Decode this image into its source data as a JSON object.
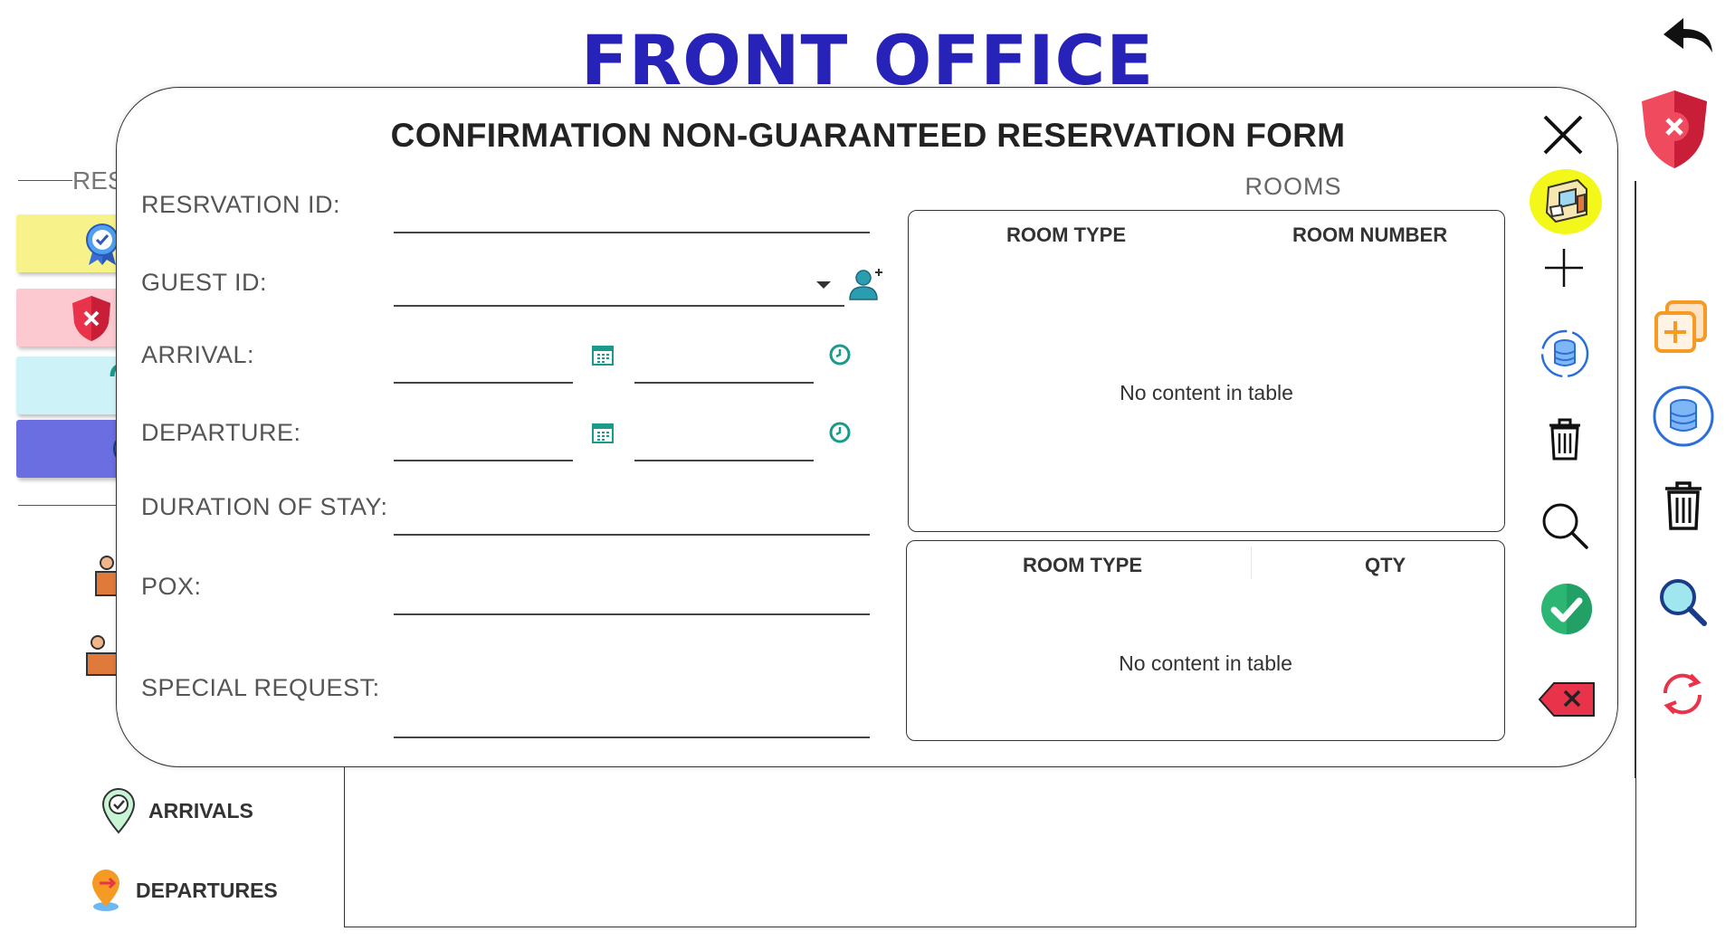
{
  "page": {
    "title": "FRONT OFFICE"
  },
  "background": {
    "section_label": "RES",
    "nav": {
      "arrivals": "ARRIVALS",
      "departures": "DEPARTURES"
    }
  },
  "modal": {
    "title": "CONFIRMATION NON-GUARANTEED RESERVATION FORM",
    "fields": {
      "reservation_id": {
        "label": "RESRVATION ID:",
        "value": ""
      },
      "guest_id": {
        "label": "GUEST ID:",
        "value": ""
      },
      "arrival": {
        "label": "ARRIVAL:",
        "date": "",
        "time": ""
      },
      "departure": {
        "label": "DEPARTURE:",
        "date": "",
        "time": ""
      },
      "duration": {
        "label": "DURATION OF STAY:",
        "value": ""
      },
      "pox": {
        "label": "POX:",
        "value": ""
      },
      "special_request": {
        "label": "SPECIAL REQUEST:",
        "value": ""
      }
    },
    "rooms": {
      "label": "ROOMS",
      "table1": {
        "columns": [
          "ROOM TYPE",
          "ROOM NUMBER"
        ],
        "empty_text": "No content in table"
      },
      "table2": {
        "columns": [
          "ROOM TYPE",
          "QTY"
        ],
        "empty_text": "No content in table"
      }
    }
  },
  "colors": {
    "title_blue": "#2722b8",
    "accent_teal": "#1a9a8a",
    "confirm_green": "#2bb673",
    "danger_red": "#e8334a"
  },
  "icons": [
    "back-arrow-icon",
    "shield-close-icon",
    "close-icon",
    "rooms-icon",
    "add-icon",
    "database-refresh-icon",
    "trash-icon",
    "search-icon",
    "check-icon",
    "backspace-icon",
    "calendar-icon",
    "clock-icon",
    "add-guest-icon",
    "add-copy-icon",
    "refresh-icon",
    "location-check-icon",
    "departure-pin-icon"
  ]
}
